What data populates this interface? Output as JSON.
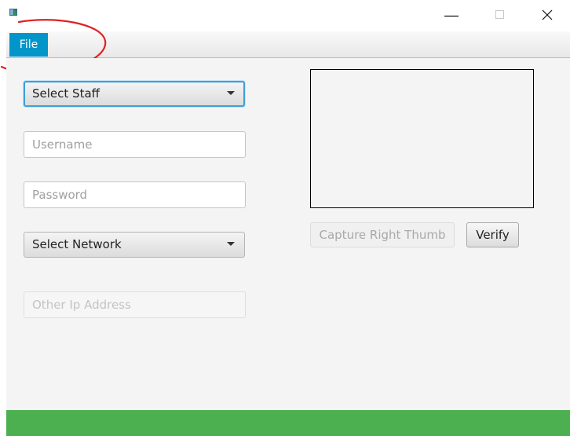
{
  "window": {
    "icon": "app-window-icon",
    "controls": {
      "minimize_icon": "minimize-icon",
      "maximize_icon": "maximize-icon",
      "close_icon": "close-icon"
    }
  },
  "menubar": {
    "items": [
      {
        "label": "File",
        "selected": true
      }
    ]
  },
  "form": {
    "staff_select": {
      "value": "Select Staff"
    },
    "username": {
      "value": "",
      "placeholder": "Username"
    },
    "password": {
      "value": "",
      "placeholder": "Password"
    },
    "network_select": {
      "value": "Select Network"
    },
    "other_ip": {
      "value": "",
      "placeholder": "Other Ip Address",
      "disabled": true
    }
  },
  "fingerprint": {
    "capture_label": "Capture Right Thumb",
    "verify_label": "Verify"
  },
  "colors": {
    "menu_selected": "#0096c9",
    "status_bar": "#4caf50",
    "annotation": "#e02020",
    "focus_ring": "#3d9fd8"
  }
}
